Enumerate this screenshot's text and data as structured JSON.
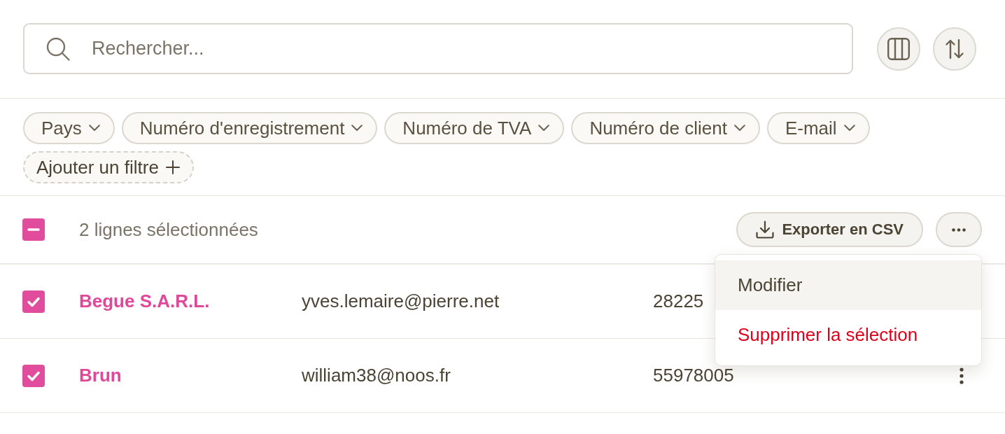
{
  "search": {
    "placeholder": "Rechercher..."
  },
  "filters": [
    {
      "kind": "dropdown",
      "label": "Pays"
    },
    {
      "kind": "dropdown",
      "label": "Numéro d'enregistrement"
    },
    {
      "kind": "dropdown",
      "label": "Numéro de TVA"
    },
    {
      "kind": "dropdown",
      "label": "Numéro de client"
    },
    {
      "kind": "dropdown",
      "label": "E-mail"
    },
    {
      "kind": "add",
      "label": "Ajouter un filtre"
    }
  ],
  "selection": {
    "indeterminate": true,
    "count": "2 lignes sélectionnées",
    "export_button": "Exporter en CSV"
  },
  "menu": {
    "items": [
      {
        "kind": "default",
        "label": "Modifier",
        "selected": true
      },
      {
        "kind": "danger",
        "label": "Supprimer la sélection",
        "selected": false
      }
    ]
  },
  "rows": [
    {
      "checked": true,
      "name": "Begue S.A.R.L.",
      "email": "yves.lemaire@pierre.net",
      "number": "28225"
    },
    {
      "checked": true,
      "name": "Brun",
      "email": "william38@noos.fr",
      "number": "55978005",
      "menu_button": true
    }
  ]
}
